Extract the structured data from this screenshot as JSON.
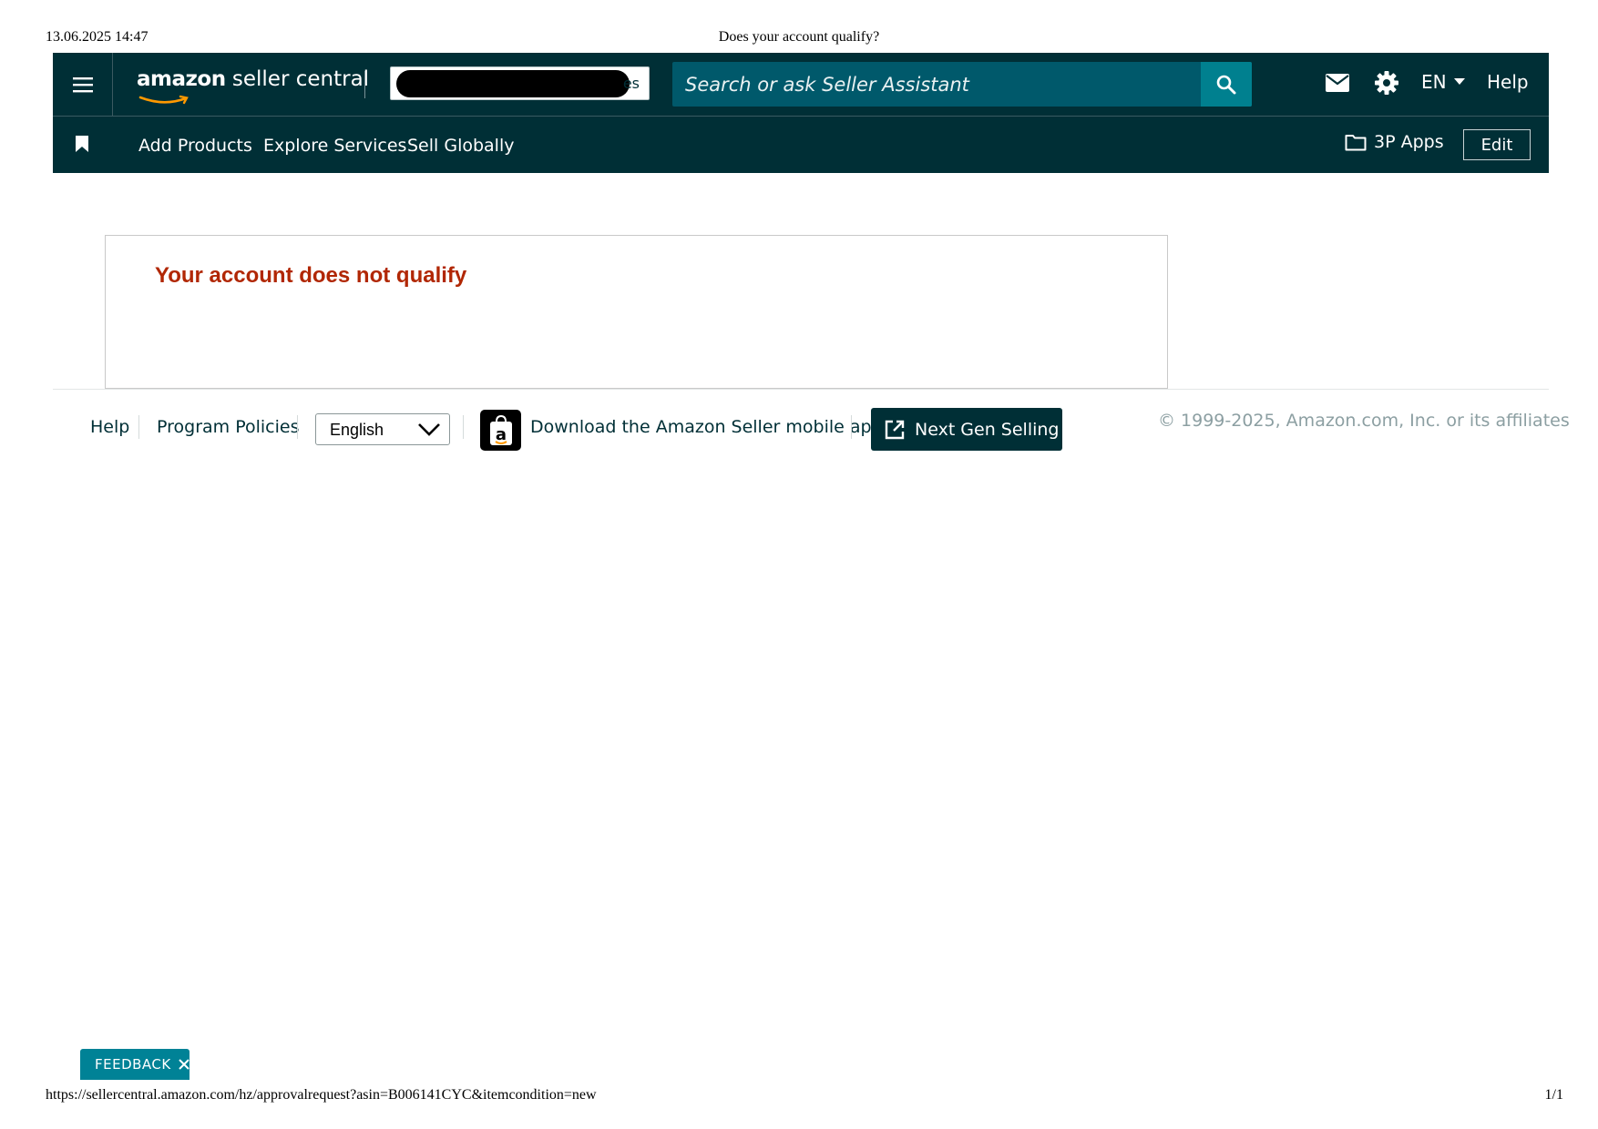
{
  "print": {
    "datetime": "13.06.2025 14:47",
    "doc_title": "Does your account qualify?",
    "url": "https://sellercentral.amazon.com/hz/approvalrequest?asin=B006141CYC&itemcondition=new",
    "page": "1/1"
  },
  "topnav": {
    "logo_amazon": "amazon",
    "logo_rest": " seller central",
    "account_suffix": "es",
    "search_placeholder": "Search or ask Seller Assistant",
    "language": "EN",
    "help": "Help"
  },
  "subnav": {
    "links": [
      "Add Products",
      "Explore Services",
      "Sell Globally"
    ],
    "apps": "3P Apps",
    "edit": "Edit"
  },
  "content": {
    "message": "Your account does not qualify",
    "message_color": "#b12704"
  },
  "footer": {
    "help": "Help",
    "policies": "Program Policies",
    "language_selected": "English",
    "mobile_app": "Download the Amazon Seller mobile app",
    "next_gen": "Next Gen Selling",
    "copyright": "© 1999-2025, Amazon.com, Inc. or its affiliates"
  },
  "feedback": {
    "label": "FEEDBACK"
  },
  "colors": {
    "nav_bg": "#002f36",
    "search_bg": "#00596b",
    "accent": "#008296"
  }
}
